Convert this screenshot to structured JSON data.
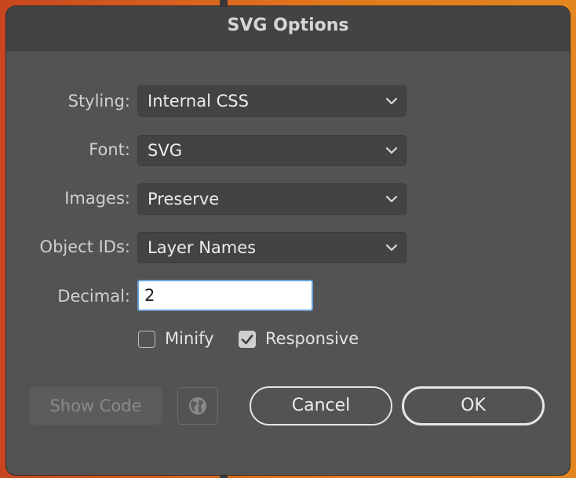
{
  "dialog": {
    "title": "SVG Options"
  },
  "fields": {
    "styling": {
      "label": "Styling:",
      "value": "Internal CSS"
    },
    "font": {
      "label": "Font:",
      "value": "SVG"
    },
    "images": {
      "label": "Images:",
      "value": "Preserve"
    },
    "object_ids": {
      "label": "Object IDs:",
      "value": "Layer Names"
    },
    "decimal": {
      "label": "Decimal:",
      "value": "2"
    }
  },
  "checkboxes": {
    "minify": {
      "label": "Minify",
      "checked": false
    },
    "responsive": {
      "label": "Responsive",
      "checked": true
    }
  },
  "buttons": {
    "show_code": "Show Code",
    "cancel": "Cancel",
    "ok": "OK"
  },
  "icons": {
    "dropdown": "chevron-down-icon",
    "globe": "globe-icon",
    "check": "checkmark-icon"
  },
  "colors": {
    "dialog_bg": "#535353",
    "titlebar_bg": "#434343",
    "field_bg": "#434343",
    "focus_ring": "#6aa0d8",
    "selection": "#f3c8de"
  }
}
